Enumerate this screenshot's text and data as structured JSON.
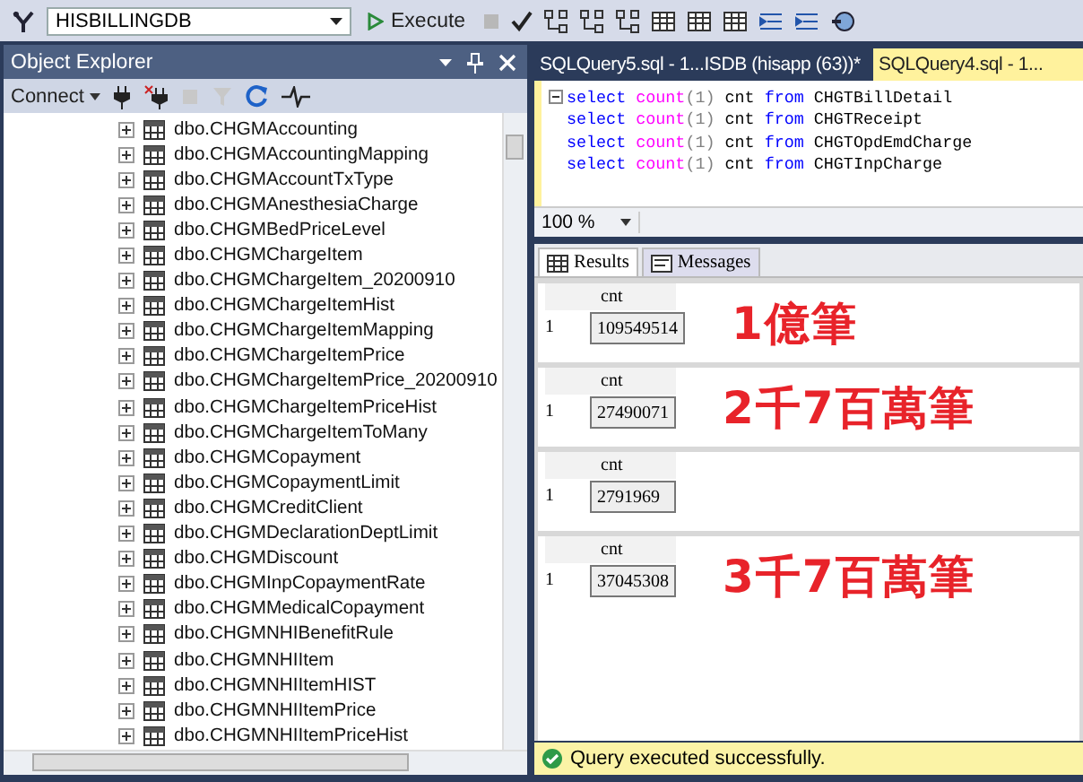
{
  "toolbar": {
    "database": "HISBILLINGDB",
    "execute": "Execute"
  },
  "object_explorer": {
    "title": "Object Explorer",
    "connect": "Connect",
    "items": [
      "dbo.CHGMAccounting",
      "dbo.CHGMAccountingMapping",
      "dbo.CHGMAccountTxType",
      "dbo.CHGMAnesthesiaCharge",
      "dbo.CHGMBedPriceLevel",
      "dbo.CHGMChargeItem",
      "dbo.CHGMChargeItem_20200910",
      "dbo.CHGMChargeItemHist",
      "dbo.CHGMChargeItemMapping",
      "dbo.CHGMChargeItemPrice",
      "dbo.CHGMChargeItemPrice_20200910",
      "dbo.CHGMChargeItemPriceHist",
      "dbo.CHGMChargeItemToMany",
      "dbo.CHGMCopayment",
      "dbo.CHGMCopaymentLimit",
      "dbo.CHGMCreditClient",
      "dbo.CHGMDeclarationDeptLimit",
      "dbo.CHGMDiscount",
      "dbo.CHGMInpCopaymentRate",
      "dbo.CHGMMedicalCopayment",
      "dbo.CHGMNHIBenefitRule",
      "dbo.CHGMNHIItem",
      "dbo.CHGMNHIItemHIST",
      "dbo.CHGMNHIItemPrice",
      "dbo.CHGMNHIItemPriceHist"
    ]
  },
  "editor_tabs": [
    {
      "label": "SQLQuery5.sql - 1...ISDB (hisapp (63))*",
      "selected": false
    },
    {
      "label": "SQLQuery4.sql - 1...",
      "selected": true
    }
  ],
  "code_lines": [
    [
      {
        "text": "select",
        "kind": "keyword"
      },
      {
        "text": " count",
        "kind": "function"
      },
      {
        "text": "(1)",
        "kind": "operator"
      },
      {
        "text": " cnt ",
        "kind": "plain"
      },
      {
        "text": "from",
        "kind": "keyword"
      },
      {
        "text": " CHGTBillDetail",
        "kind": "plain"
      }
    ],
    [
      {
        "text": "select",
        "kind": "keyword"
      },
      {
        "text": " count",
        "kind": "function"
      },
      {
        "text": "(1)",
        "kind": "operator"
      },
      {
        "text": " cnt ",
        "kind": "plain"
      },
      {
        "text": "from",
        "kind": "keyword"
      },
      {
        "text": " CHGTReceipt",
        "kind": "plain"
      }
    ],
    [
      {
        "text": "select",
        "kind": "keyword"
      },
      {
        "text": " count",
        "kind": "function"
      },
      {
        "text": "(1)",
        "kind": "operator"
      },
      {
        "text": " cnt ",
        "kind": "plain"
      },
      {
        "text": "from",
        "kind": "keyword"
      },
      {
        "text": " CHGTOpdEmdCharge",
        "kind": "plain"
      }
    ],
    [
      {
        "text": "select",
        "kind": "keyword"
      },
      {
        "text": " count",
        "kind": "function"
      },
      {
        "text": "(1)",
        "kind": "operator"
      },
      {
        "text": " cnt ",
        "kind": "plain"
      },
      {
        "text": "from",
        "kind": "keyword"
      },
      {
        "text": " CHGTInpCharge",
        "kind": "plain"
      }
    ]
  ],
  "zoom": "100 %",
  "result_tabs": [
    {
      "label": "Results",
      "selected": true
    },
    {
      "label": "Messages",
      "selected": false
    }
  ],
  "result_sets": [
    {
      "column": "cnt",
      "row_number": "1",
      "value": "109549514",
      "note": "1億筆"
    },
    {
      "column": "cnt",
      "row_number": "1",
      "value": "27490071",
      "note": "2千7百萬筆"
    },
    {
      "column": "cnt",
      "row_number": "1",
      "value": "2791969"
    },
    {
      "column": "cnt",
      "row_number": "1",
      "value": "37045308",
      "note": "3千7百萬筆"
    }
  ],
  "status": "Query executed successfully."
}
